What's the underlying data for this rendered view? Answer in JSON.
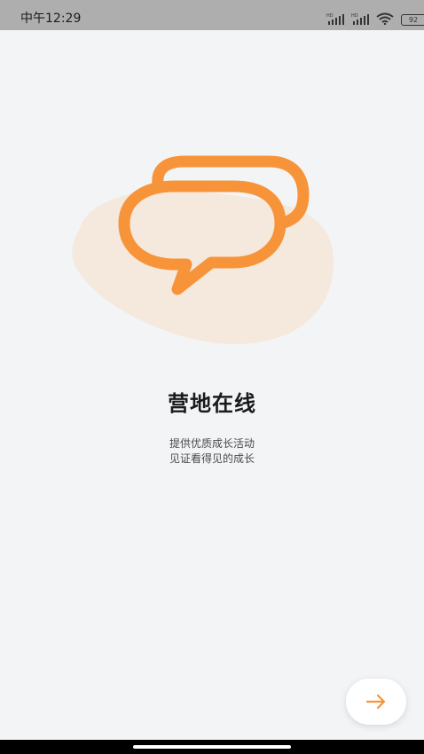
{
  "status_bar": {
    "time": "中午12:29",
    "battery_level": "92",
    "signal_icon": "signal-icon",
    "wifi_icon": "wifi-icon"
  },
  "onboarding": {
    "illustration_icon": "chat-bubbles-icon",
    "title": "营地在线",
    "subtitle_line1": "提供优质成长活动",
    "subtitle_line2": "见证看得见的成长",
    "next_icon": "arrow-right-icon"
  },
  "colors": {
    "accent": "#F7943A",
    "blob": "#F5E8DC",
    "background": "#F3F4F6",
    "status_bar": "#AEAEAE"
  }
}
